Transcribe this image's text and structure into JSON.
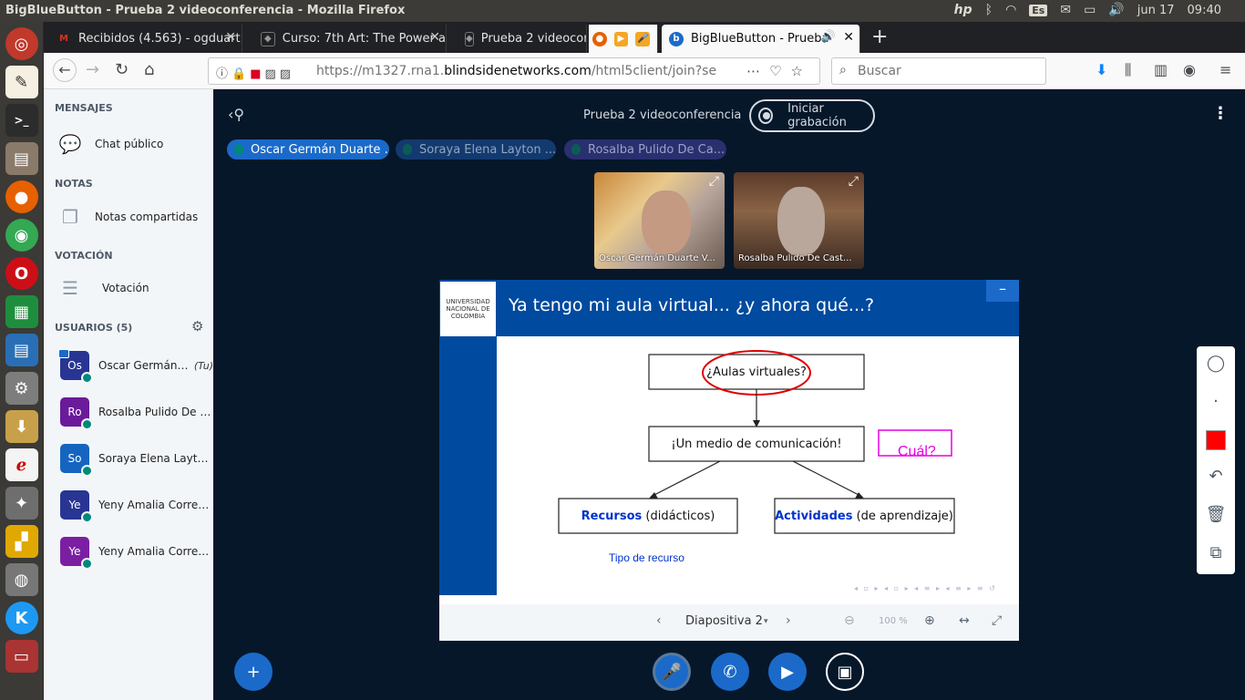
{
  "os": {
    "window_title": "BigBlueButton - Prueba 2 videoconferencia - Mozilla Firefox",
    "language": "Es",
    "date": "jun 17",
    "time": "09:40"
  },
  "browser": {
    "tabs": [
      {
        "label": "Recibidos (4.563) - ogduart",
        "favicon": "gmail-icon"
      },
      {
        "label": "Curso: 7th Art: The Power a",
        "favicon": "course-icon"
      },
      {
        "label": "Prueba 2 videoconf",
        "favicon": "course-icon"
      },
      {
        "label": "BigBlueButton - Prueba",
        "favicon": "bbb-icon",
        "active": true
      }
    ],
    "url_prefix": "https://m1327.rna1.",
    "url_domain": "blindsidenetworks.com",
    "url_rest": "/html5client/join?sessionToke",
    "search_placeholder": "Buscar"
  },
  "sidebar": {
    "messages_title": "MENSAJES",
    "public_chat": "Chat público",
    "notes_title": "NOTAS",
    "shared_notes": "Notas compartidas",
    "poll_title": "VOTACIÓN",
    "poll": "Votación",
    "users_title": "USUARIOS (5)",
    "users": [
      {
        "initials": "Os",
        "name": "Oscar Germán D...",
        "you": "(Tu)",
        "color": "#283593"
      },
      {
        "initials": "Ro",
        "name": "Rosalba Pulido De C...",
        "color": "#6a1b9a"
      },
      {
        "initials": "So",
        "name": "Soraya Elena Layton ...",
        "color": "#1565c0"
      },
      {
        "initials": "Ye",
        "name": "Yeny Amalia Correal...",
        "color": "#283593"
      },
      {
        "initials": "Ye",
        "name": "Yeny Amalia Correal...",
        "color": "#7b1fa2"
      }
    ]
  },
  "meeting": {
    "title": "Prueba 2 videoconferencia",
    "record_label": "Iniciar grabación",
    "talkers": [
      {
        "name": "Oscar Germán Duarte ..."
      },
      {
        "name": "Soraya Elena Layton ..."
      },
      {
        "name": "Rosalba Pulido De Ca..."
      }
    ],
    "videos": [
      {
        "label": "Oscar Germán Duarte V..."
      },
      {
        "label": "Rosalba Pulido De Cast..."
      }
    ]
  },
  "slide": {
    "logo_text": "UNIVERSIDAD NACIONAL DE COLOMBIA",
    "title": "Ya tengo mi aula virtual... ¿y ahora qué...?",
    "box1": "¿Aulas virtuales?",
    "box2": "¡Un medio de comunicación!",
    "box3_bold": "Recursos",
    "box3_rest": " (didácticos)",
    "box4_bold": "Actividades",
    "box4_rest": " (de aprendizaje)",
    "annotation_text": "Cuál?",
    "resource_type": "Tipo de recurso"
  },
  "presentation_controls": {
    "slide_label": "Diapositiva 2",
    "zoom": "100 %"
  },
  "colors": {
    "accent": "#1b6ac9",
    "slide_blue": "#004a9f",
    "annotation_red": "#ff0000",
    "annotation_magenta": "#e600e6"
  }
}
